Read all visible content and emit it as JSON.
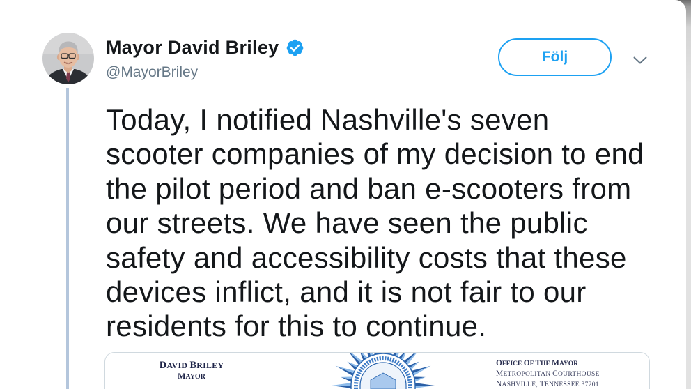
{
  "colors": {
    "accent": "#1da1f2",
    "text_primary": "#14171a",
    "text_secondary": "#657786",
    "thread_line": "#b4c6dc",
    "seal_blue": "#2a66b0"
  },
  "author": {
    "name": "Mayor David Briley",
    "handle": "@MayorBriley",
    "verified": true,
    "avatar_icon": "avatar-photo",
    "verified_icon": "verified-badge-icon"
  },
  "actions": {
    "follow_label": "Följ",
    "menu_icon": "chevron-down-icon"
  },
  "tweet": {
    "text_lines": [
      "Today, I notified Nashville's seven",
      "scooter companies of my decision to end",
      "the pilot period and ban e-scooters from",
      "our streets. We have seen the public",
      "safety and accessibility costs that these",
      "devices inflict, and it is not fair to our",
      "residents for this to continue."
    ]
  },
  "media": {
    "letterhead": {
      "left": {
        "name": "DAVID BRILEY",
        "title": "MAYOR"
      },
      "seal_icon": "metro-seal-icon",
      "right": {
        "lines": [
          "OFFICE OF THE MAYOR",
          "METROPOLITAN COURTHOUSE",
          "NASHVILLE, TENNESSEE 37201"
        ]
      }
    }
  }
}
